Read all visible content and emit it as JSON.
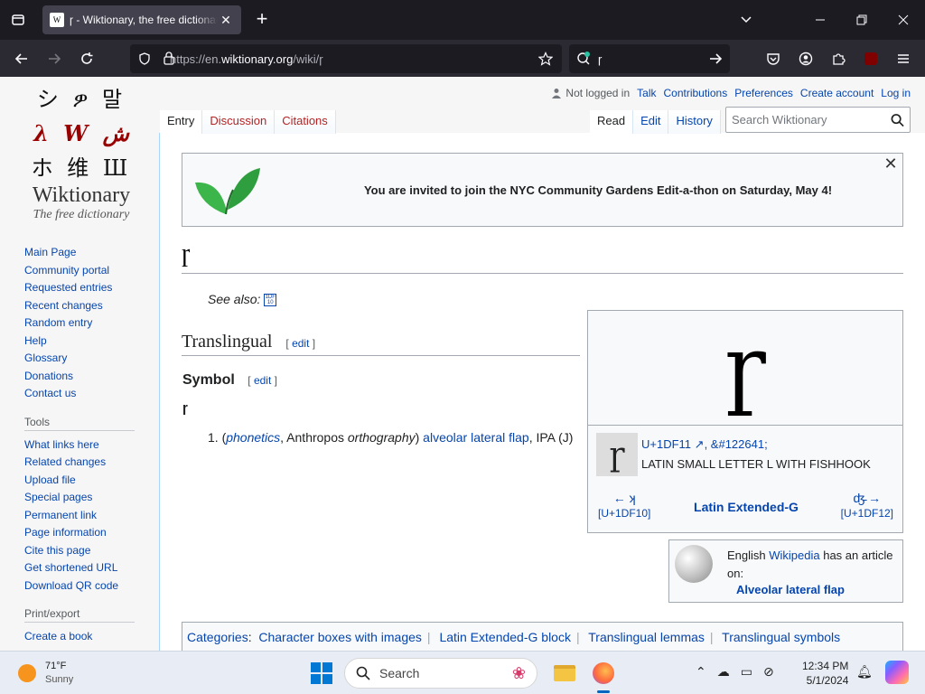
{
  "browser": {
    "tab_title": "ɼ - Wiktionary, the free dictionary",
    "tab_favicon": "W",
    "url_prefix": "https://en.",
    "url_domain": "wiktionary.org",
    "url_path": "/wiki/ɼ",
    "search_value": "ɼ"
  },
  "logo": {
    "row1": "シ ዎ 말",
    "row2": "λ W ش",
    "row3": "ホ 维 Ш",
    "name": "Wiktionary",
    "tagline": "The free dictionary"
  },
  "sidebar": {
    "nav": [
      "Main Page",
      "Community portal",
      "Requested entries",
      "Recent changes",
      "Random entry",
      "Help",
      "Glossary",
      "Donations",
      "Contact us"
    ],
    "tools_heading": "Tools",
    "tools": [
      "What links here",
      "Related changes",
      "Upload file",
      "Special pages",
      "Permanent link",
      "Page information",
      "Cite this page",
      "Get shortened URL",
      "Download QR code"
    ],
    "print_heading": "Print/export",
    "print": [
      "Create a book"
    ]
  },
  "personal": {
    "not_logged_in": "Not logged in",
    "talk": "Talk",
    "contributions": "Contributions",
    "preferences": "Preferences",
    "create_account": "Create account",
    "login": "Log in"
  },
  "tabs": {
    "entry": "Entry",
    "discussion": "Discussion",
    "citations": "Citations",
    "read": "Read",
    "edit": "Edit",
    "history": "History"
  },
  "search": {
    "placeholder": "Search Wiktionary"
  },
  "sitenotice": "You are invited to join the NYC Community Gardens Edit-a-thon on Saturday, May 4!",
  "article": {
    "title": "ɼ",
    "see_also_label": "See also:",
    "see_also_box": "1DF 10",
    "h2": "Translingual",
    "h3": "Symbol",
    "edit_open": "[",
    "edit_label": "edit",
    "edit_close": "]",
    "headword": "ɼ",
    "def_num": "1. (",
    "def_l1": "phonetics",
    "def_t1": ", Anthropos ",
    "def_t2": "orthography",
    "def_t3": ") ",
    "def_l2": "alveolar lateral flap",
    "def_t4": ", IPA (J)"
  },
  "charbox": {
    "char": "ɼ",
    "codepoint": "U+1DF11",
    "entity": "&#122641;",
    "name": "LATIN SMALL LETTER L WITH FISHHOOK",
    "prev_arrow": "← ʞ",
    "prev_code": "[U+1DF10]",
    "block": "Latin Extended-G",
    "next_arrow": "ʤ̵ →",
    "next_code": "[U+1DF12]"
  },
  "wikipedia": {
    "t1": "English ",
    "link": "Wikipedia",
    "t2": " has an article on:",
    "article": "Alveolar lateral flap"
  },
  "categories": {
    "label": "Categories",
    "items": [
      "Character boxes with images",
      "Latin Extended-G block",
      "Translingual lemmas",
      "Translingual symbols"
    ]
  },
  "taskbar": {
    "temp": "71°F",
    "condition": "Sunny",
    "search_label": "Search",
    "time": "12:34 PM",
    "date": "5/1/2024"
  }
}
